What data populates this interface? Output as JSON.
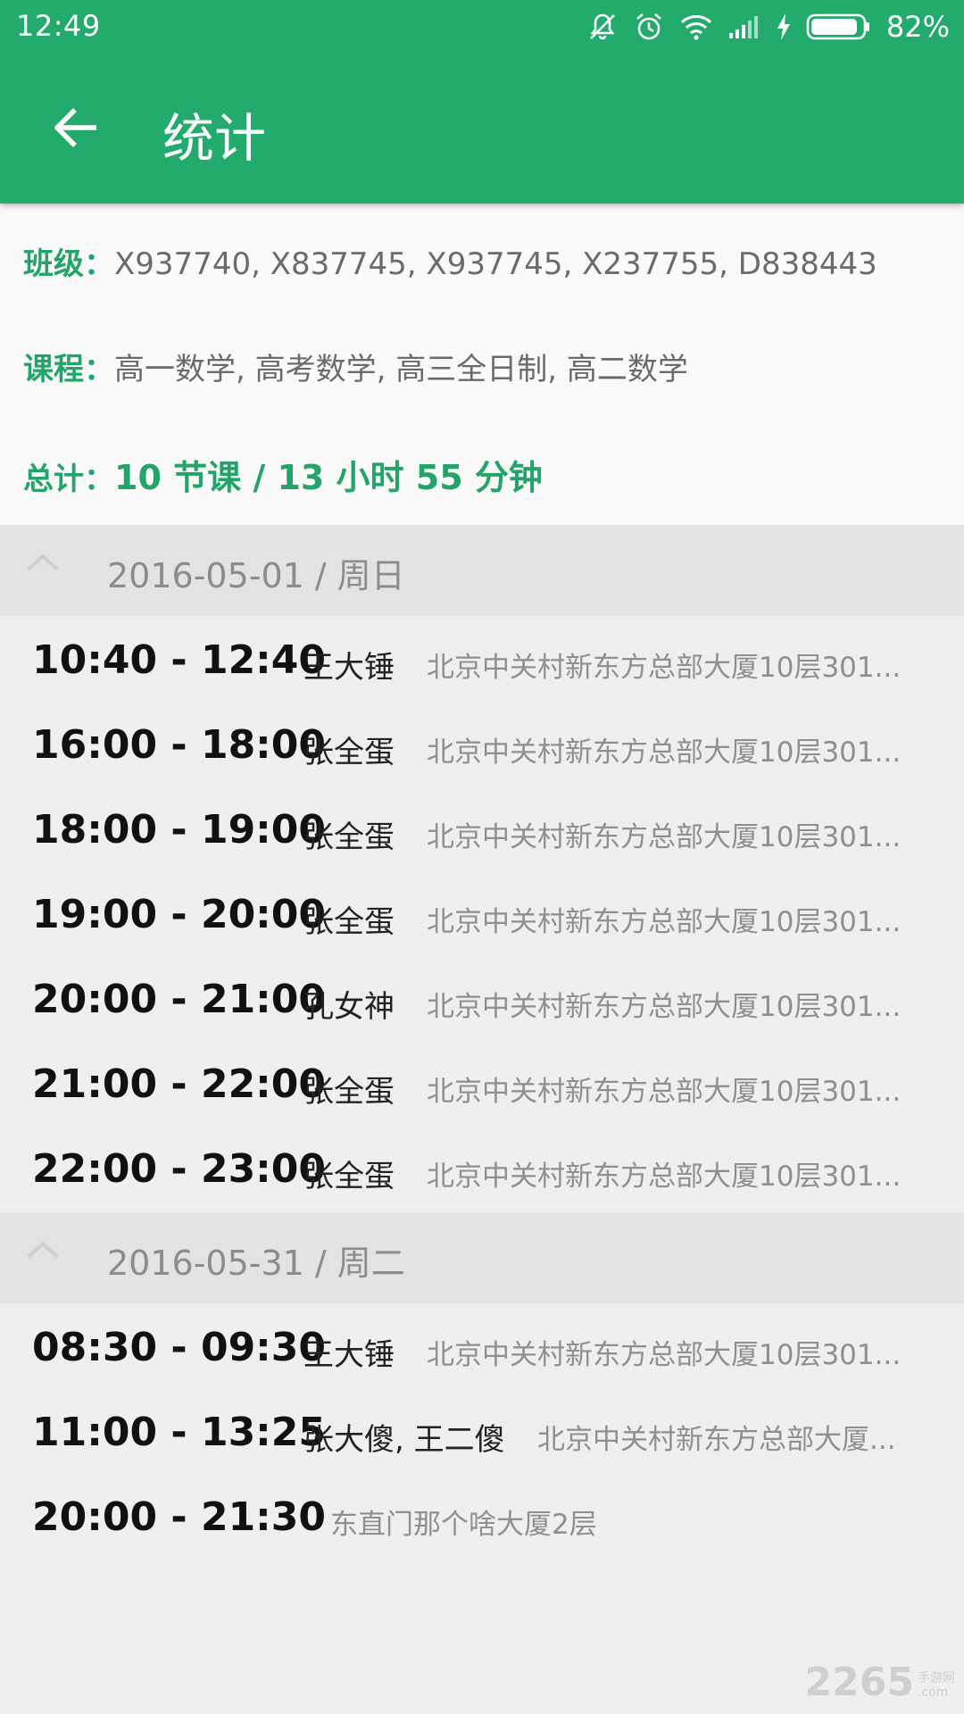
{
  "status": {
    "time": "12:49",
    "battery": "82%"
  },
  "appbar": {
    "title": "统计"
  },
  "summary": {
    "class_label": "班级：",
    "class_value": "X937740, X837745, X937745, X237755, D838443",
    "course_label": "课程：",
    "course_value": "高一数学, 高考数学, 高三全日制, 高二数学",
    "total_label": "总计：",
    "total_value": "10 节课 / 13 小时 55 分钟"
  },
  "groups": [
    {
      "date": "2016-05-01 / 周日",
      "rows": [
        {
          "time": "10:40 - 12:40",
          "teacher": "王大锤",
          "location": "北京中关村新东方总部大厦10层301..."
        },
        {
          "time": "16:00 - 18:00",
          "teacher": "张全蛋",
          "location": "北京中关村新东方总部大厦10层301..."
        },
        {
          "time": "18:00 - 19:00",
          "teacher": "张全蛋",
          "location": "北京中关村新东方总部大厦10层301..."
        },
        {
          "time": "19:00 - 20:00",
          "teacher": "张全蛋",
          "location": "北京中关村新东方总部大厦10层301..."
        },
        {
          "time": "20:00 - 21:00",
          "teacher": "孔女神",
          "location": "北京中关村新东方总部大厦10层301..."
        },
        {
          "time": "21:00 - 22:00",
          "teacher": "张全蛋",
          "location": "北京中关村新东方总部大厦10层301..."
        },
        {
          "time": "22:00 - 23:00",
          "teacher": "张全蛋",
          "location": "北京中关村新东方总部大厦10层301..."
        }
      ]
    },
    {
      "date": "2016-05-31 / 周二",
      "rows": [
        {
          "time": "08:30 - 09:30",
          "teacher": "王大锤",
          "location": "北京中关村新东方总部大厦10层301..."
        },
        {
          "time": "11:00 - 13:25",
          "teacher": "张大傻, 王二傻",
          "location": "北京中关村新东方总部大厦..."
        },
        {
          "time": "20:00 - 21:30",
          "teacher": "",
          "location": "东直门那个啥大厦2层"
        }
      ]
    }
  ],
  "watermark": {
    "number": "2265",
    "text1": "手游网",
    "text2": ".com"
  },
  "icons": {
    "back": "arrow-left-icon",
    "collapse": "chevron-up-icon",
    "status": [
      "mute-icon",
      "alarm-icon",
      "wifi-icon",
      "signal-icon",
      "charging-icon",
      "battery-icon"
    ]
  },
  "colors": {
    "primary": "#23aa6d",
    "accent_text": "#23a569",
    "group_bg": "#e3e3e3"
  }
}
